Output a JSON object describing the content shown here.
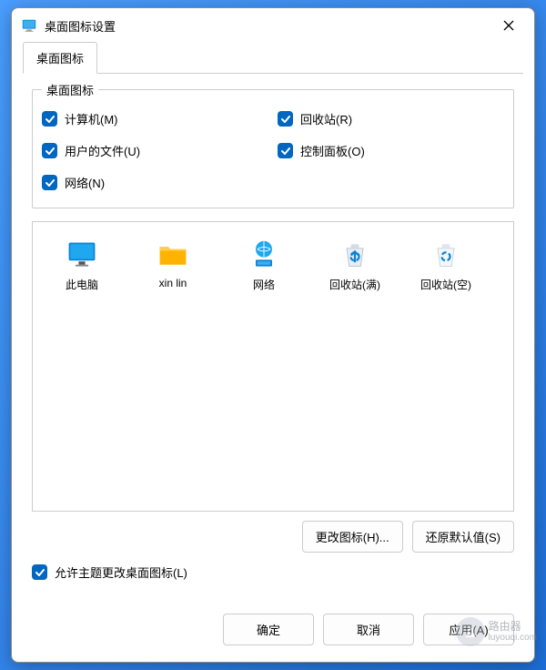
{
  "window": {
    "title": "桌面图标设置"
  },
  "tab": {
    "label": "桌面图标"
  },
  "group": {
    "title": "桌面图标"
  },
  "checkboxes": {
    "computer": {
      "label": "计算机(M)",
      "checked": true
    },
    "recyclebin": {
      "label": "回收站(R)",
      "checked": true
    },
    "userfiles": {
      "label": "用户的文件(U)",
      "checked": true
    },
    "controlpanel": {
      "label": "控制面板(O)",
      "checked": true
    },
    "network": {
      "label": "网络(N)",
      "checked": true
    }
  },
  "icons": {
    "thispc": {
      "label": "此电脑"
    },
    "userfolder": {
      "label": "xin lin"
    },
    "network": {
      "label": "网络"
    },
    "recyclefull": {
      "label": "回收站(满)"
    },
    "recycleempty": {
      "label": "回收站(空)"
    }
  },
  "buttons": {
    "changeicon": "更改图标(H)...",
    "restoredefaults": "还原默认值(S)",
    "ok": "确定",
    "cancel": "取消",
    "apply": "应用(A)"
  },
  "allowtheme": {
    "label": "允许主题更改桌面图标(L)",
    "checked": true
  },
  "watermark": {
    "text1": "路由器",
    "text2": "luyouqi.com"
  }
}
